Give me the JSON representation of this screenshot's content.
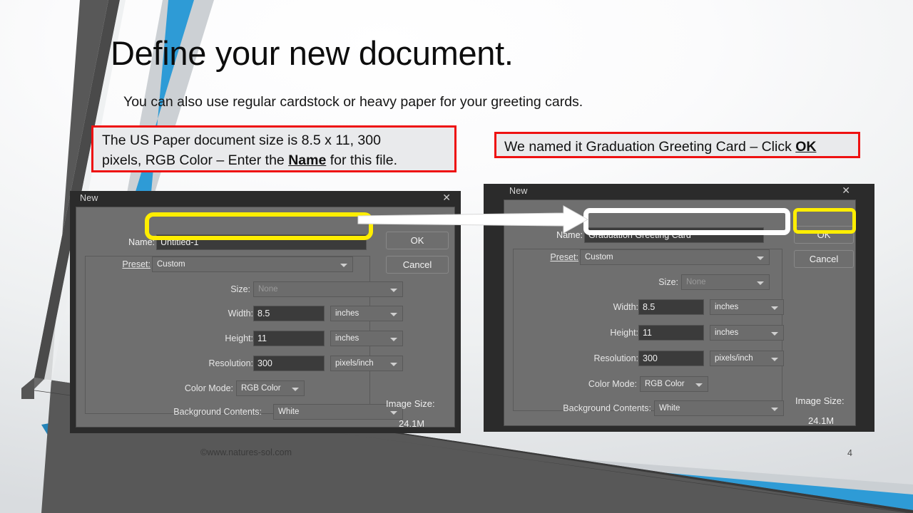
{
  "slide": {
    "title": "Define your new document.",
    "subtitle": "You can also use regular cardstock or heavy paper for your greeting cards.",
    "footer_copyright": "©www.natures-sol.com",
    "page_number": "4",
    "colors": {
      "accent_blue": "#2e9bd6",
      "band_gray": "#585858",
      "callout_red": "#ee1111",
      "highlight_yellow": "#ffee00",
      "dialog_gray": "#6f6f6f"
    }
  },
  "callouts": {
    "left": {
      "line1": "The US Paper document size is 8.5 x 11, 300",
      "line2_a": "pixels, RGB Color – Enter the ",
      "line2_emph": "Name",
      "line2_b": " for this file."
    },
    "right": {
      "text_a": "We named it Graduation Greeting Card – Click ",
      "text_emph": "OK"
    }
  },
  "dialog_left": {
    "title": "New",
    "close_icon": "close-icon",
    "name_label": "Name:",
    "name_value": "Untitled-1",
    "preset_label": "Preset:",
    "preset_value": "Custom",
    "size_label": "Size:",
    "size_value": "None",
    "width_label": "Width:",
    "width_value": "8.5",
    "width_unit": "inches",
    "height_label": "Height:",
    "height_value": "11",
    "height_unit": "inches",
    "resolution_label": "Resolution:",
    "resolution_value": "300",
    "resolution_unit": "pixels/inch",
    "color_mode_label": "Color Mode:",
    "color_mode_value": "RGB Color",
    "background_label": "Background Contents:",
    "background_value": "White",
    "image_size_label": "Image Size:",
    "image_size_value": "24.1M",
    "ok_label": "OK",
    "cancel_label": "Cancel"
  },
  "dialog_right": {
    "title": "New",
    "close_icon": "close-icon",
    "name_label": "Name:",
    "name_value": "Graduation Greeting Card",
    "preset_label": "Preset:",
    "preset_value": "Custom",
    "size_label": "Size:",
    "size_value": "None",
    "width_label": "Width:",
    "width_value": "8.5",
    "width_unit": "inches",
    "height_label": "Height:",
    "height_value": "11",
    "height_unit": "inches",
    "resolution_label": "Resolution:",
    "resolution_value": "300",
    "resolution_unit": "pixels/inch",
    "color_mode_label": "Color Mode:",
    "color_mode_value": "RGB Color",
    "background_label": "Background Contents:",
    "background_value": "White",
    "image_size_label": "Image Size:",
    "image_size_value": "24.1M",
    "ok_label": "OK",
    "cancel_label": "Cancel"
  },
  "annotations": {
    "arrow_icon": "right-arrow-icon",
    "highlight_name_field_left": "yellow-highlight",
    "highlight_name_field_right": "white-highlight",
    "highlight_ok_right": "yellow-highlight"
  }
}
